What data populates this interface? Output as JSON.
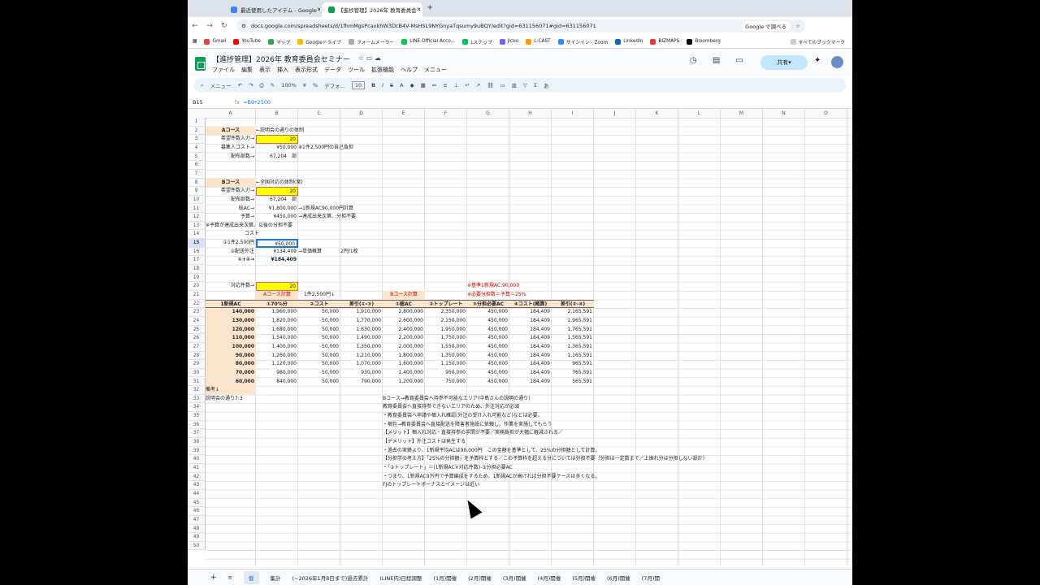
{
  "tabs": [
    {
      "label": "最近使用したアイテム - Google",
      "active": false
    },
    {
      "label": "【進捗管理】2026年 教育委員会",
      "active": true
    }
  ],
  "url": "docs.google.com/spreadsheets/d/1fhmMgsPcavkhW3DcB4V-MsHSL9NYGnyaTqsumy9uBQY/edit?gid=631156071#gid=631156071",
  "google_search_btn": "Google で調べる",
  "bookmarks": [
    "Gmail",
    "YouTube",
    "マップ",
    "Googleドライブ",
    "フォームメーラー",
    "LINE Official Acco...",
    "Lステップ",
    "Jicoo",
    "L-CAST",
    "サインイン - Zoom",
    "LinkedIn",
    "BIZMAPS",
    "Bloomberg",
    "すべてのブックマーク"
  ],
  "doc": {
    "title": "【進捗管理】2026年 教育委員会セミナー",
    "menus": [
      "ファイル",
      "編集",
      "表示",
      "挿入",
      "表示形式",
      "データ",
      "ツール",
      "拡張機能",
      "ヘルプ",
      "メニュー"
    ],
    "share_label": "共有"
  },
  "toolbar": {
    "menu_label": "メニュー",
    "zoom": "100%",
    "currency": "¥",
    "percent": "%",
    "font": "デフォ...",
    "font_size": "10"
  },
  "formula": {
    "cell_ref": "B15",
    "fx": "fx",
    "formula": "=B9*2500"
  },
  "columns": [
    "A",
    "B",
    "C",
    "D",
    "E",
    "F",
    "G",
    "H",
    "I",
    "J",
    "K",
    "L",
    "M",
    "N",
    "O"
  ],
  "rows": [
    "1",
    "2",
    "3",
    "4",
    "5",
    "6",
    "7",
    "8",
    "9",
    "10",
    "11",
    "12",
    "13",
    "14",
    "15",
    "16",
    "17",
    "18",
    "19",
    "20",
    "21",
    "22",
    "23",
    "24",
    "25",
    "26",
    "27",
    "28",
    "29",
    "30",
    "31",
    "32",
    "33",
    "34",
    "35",
    "36",
    "37",
    "38",
    "39",
    "40",
    "41",
    "42",
    "43",
    "44",
    "45",
    "46",
    "47",
    "48",
    "49",
    "50"
  ],
  "sheet": {
    "a_course": "Aコース",
    "a_note": "←説明会の通りの体制",
    "hope_label": "希望件数入力→",
    "hope_val": "20",
    "recruit_cost_label": "募集人コスト→",
    "recruit_cost_val": "¥50,000",
    "recruit_cost_note": "※1件2,500円の自己負担",
    "dist_label": "配布部数→",
    "dist_val": "67,204",
    "dist_unit": "部",
    "b_course": "Bコース",
    "b_note": "←全国対応の体制(案)",
    "b_hope_label": "希望件数入力→",
    "b_hope_val": "20",
    "b_dist_label": "配布部数→",
    "b_dist_val": "67,204",
    "b_dist_unit": "部",
    "total_ac_label": "総AC→",
    "total_ac_val": "¥1,800,000",
    "total_ac_note": "→1新規AC90,000円計算",
    "budget_label": "予算→",
    "budget_val": "¥450,000",
    "budget_note": "→達成出来次第、分担不要",
    "r13": "※予算が達成出来次第、以後の分担不要",
    "cost": "コスト",
    "c1_label": "①1件2,500円",
    "c1_val": "¥50,000",
    "c2_label": "②配送外注",
    "c2_val": "¥134,409",
    "c2_note": "→単価概算",
    "c2_note2": "2円/1枚",
    "c12_label": "①+②→",
    "c12_val": "¥184,409",
    "resp_label": "対応件数→",
    "resp_val": "20",
    "a_calc": "Aコース計算",
    "a_calc_note": "1件2,500円↓",
    "b_calc": "Bコース計算",
    "base_note": "※基準1新規AC:90,000",
    "need_note": "※必要分担数＝予算＝25%",
    "thead": [
      "1新規AC",
      "①70%分",
      "②コスト",
      "差引(①-②)",
      "①総AC",
      "②トップレート",
      "③分担必要AC",
      "④コスト(概算)",
      "差引(②-④)"
    ],
    "table": [
      [
        "140,000",
        "1,960,000",
        "50,000",
        "1,910,000",
        "2,800,000",
        "2,350,000",
        "450,000",
        "184,409",
        "2,165,591"
      ],
      [
        "130,000",
        "1,820,000",
        "50,000",
        "1,770,000",
        "2,600,000",
        "2,150,000",
        "450,000",
        "184,409",
        "1,965,591"
      ],
      [
        "120,000",
        "1,680,000",
        "50,000",
        "1,630,000",
        "2,400,000",
        "1,950,000",
        "450,000",
        "184,409",
        "1,765,591"
      ],
      [
        "110,000",
        "1,540,000",
        "50,000",
        "1,490,000",
        "2,200,000",
        "1,750,000",
        "450,000",
        "184,409",
        "1,565,591"
      ],
      [
        "100,000",
        "1,400,000",
        "50,000",
        "1,350,000",
        "2,000,000",
        "1,550,000",
        "450,000",
        "184,409",
        "1,365,591"
      ],
      [
        "90,000",
        "1,260,000",
        "50,000",
        "1,210,000",
        "1,800,000",
        "1,350,000",
        "450,000",
        "184,409",
        "1,165,591"
      ],
      [
        "80,000",
        "1,120,000",
        "50,000",
        "1,070,000",
        "1,600,000",
        "1,150,000",
        "450,000",
        "184,409",
        "965,591"
      ],
      [
        "70,000",
        "980,000",
        "50,000",
        "930,000",
        "1,400,000",
        "950,000",
        "450,000",
        "184,409",
        "765,591"
      ],
      [
        "60,000",
        "840,000",
        "50,000",
        "790,000",
        "1,200,000",
        "750,000",
        "450,000",
        "184,409",
        "565,591"
      ]
    ],
    "remarks": "備考↓",
    "r33a": "説明会の通り7:3",
    "notes": [
      "Bコース→教育委員会へ持参不可能なエリア(中島さんの説明の通り)",
      "教育委員会へ直接持参できないエリアのため、外注対応が必須",
      "・教育委員会へ申請や梱入れ確認(外注の受け入れ可能など)などは必要。",
      "・梱包→教育委員会へ直接配送を障害者施設に依頼し、作業を実施してもらう",
      "【メリット】梱入れ対応・直接持参の手間が不要／実務負担が大幅に軽減される／",
      "【デメリット】外注コストは発生する",
      "・過去の実績より、1新規平均ACは90,000円　この金額を基準として、25%の分担額として計算。",
      "【分担学の考え方】「25%の分担額」を予算枠とする／この予算枠を超える分については分担不要（分担は一定数まで／上振れ分は分担しない設計）",
      "・「②トップレート」＝(1新規AC×対応件数)-③分担必要AC",
      "・つまり、1新規AC9万円で予算編成をするため、1新規ACが高ければ分担不要ケースは多くなる。",
      "FJのトップレートボーナスとイメージは近い"
    ]
  },
  "sheet_tabs": [
    "仮",
    "集計",
    "(~2026年1月8日まで)過去累計",
    "(LINE内)日程調整",
    "(1月)開催",
    "(2月)開催",
    "(3月)開催",
    "(4月)開催",
    "(5月)開催",
    "(6月)開催",
    "(7月)開"
  ]
}
